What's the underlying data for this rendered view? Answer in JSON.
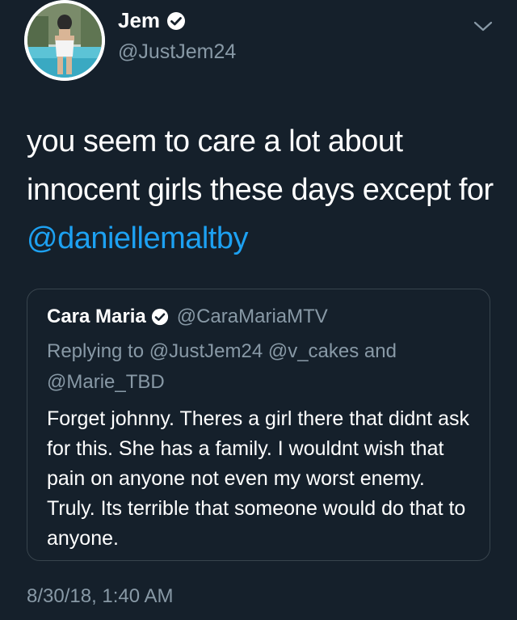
{
  "tweet": {
    "author": {
      "display_name": "Jem",
      "handle": "@JustJem24",
      "verified": true
    },
    "text_before": "you seem to care a lot about innocent girls these days except for ",
    "mention": "@daniellemaltby",
    "timestamp": "8/30/18, 1:40 AM"
  },
  "quote": {
    "author": {
      "display_name": "Cara Maria",
      "handle": "@CaraMariaMTV",
      "verified": true
    },
    "replying_prefix": "Replying to ",
    "replying_to_1": "@JustJem24",
    "replying_to_2": "@v_cakes",
    "replying_and": " and ",
    "replying_to_3": "@Marie_TBD",
    "body": "Forget johnny. Theres a girl there that didnt ask for this. She has a family. I wouldnt wish that pain on anyone not even my worst enemy. Truly. Its terrible that someone would do that to anyone."
  },
  "icons": {
    "verified": "verified-badge-icon",
    "menu": "chevron-down-icon"
  },
  "colors": {
    "background": "#15202b",
    "link": "#1da1f2",
    "muted": "#8899a6",
    "border": "#38444d"
  }
}
